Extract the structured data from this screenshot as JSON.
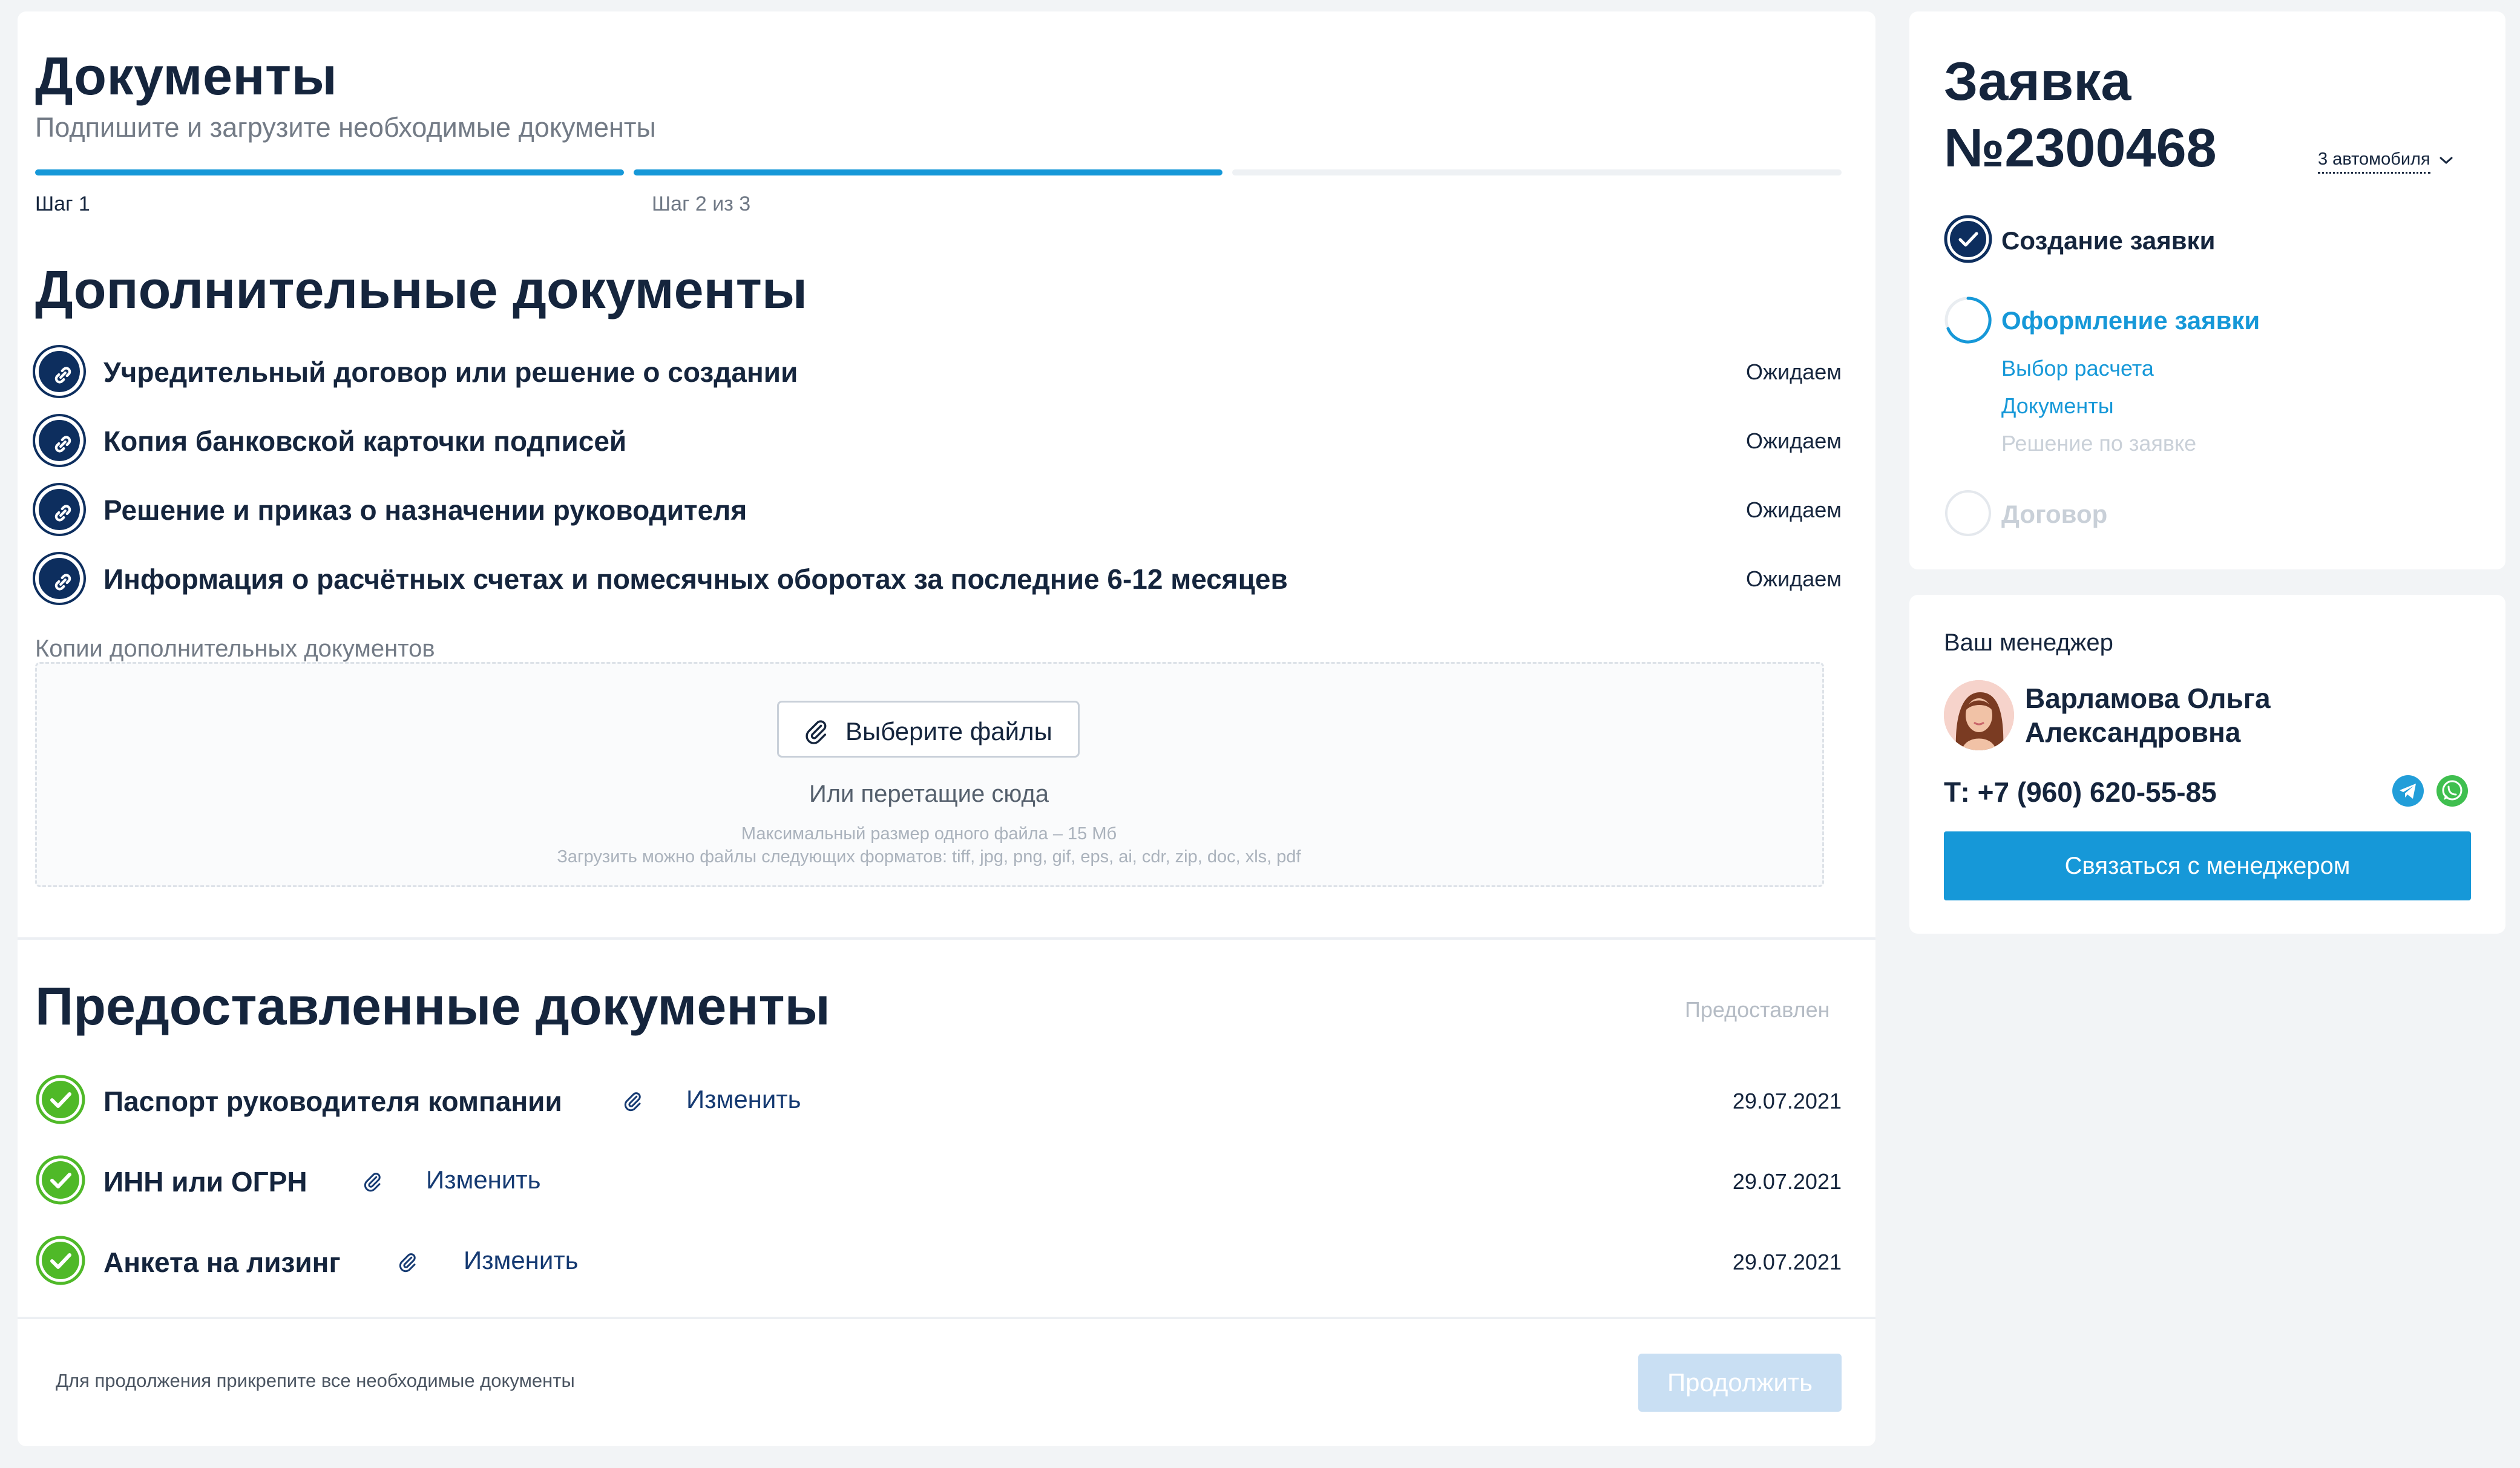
{
  "header": {
    "title": "Документы",
    "subtitle": "Подпишите и загрузите необходимые документы",
    "step1_label": "Шаг 1",
    "step2_label": "Шаг 2 из 3",
    "progress_steps_completed": 2,
    "progress_steps_total": 3
  },
  "additional": {
    "title": "Дополнительные документы",
    "items": [
      {
        "title": "Учредительный договор или решение о создании",
        "status": "Ожидаем"
      },
      {
        "title": "Копия банковской карточки подписей",
        "status": "Ожидаем"
      },
      {
        "title": "Решение и приказ о назначении руководителя",
        "status": "Ожидаем"
      },
      {
        "title": "Информация о расчётных счетах и помесячных оборотах за последние 6-12 месяцев",
        "status": "Ожидаем"
      }
    ],
    "copies_label": "Копии дополнительных документов",
    "upload": {
      "button_label": "Выберите файлы",
      "drag_text": "Или перетащие сюда",
      "max_size_hint": "Максимальный размер одного файла – 15 Мб",
      "formats_hint": "Загрузить можно файлы следующих форматов: tiff, jpg, png, gif, eps, ai, cdr, zip, doc, xls, pdf"
    }
  },
  "provided": {
    "title": "Предоставленные документы",
    "status_header": "Предоставлен",
    "items": [
      {
        "title": "Паспорт руководителя компании",
        "action": "Изменить",
        "date": "29.07.2021"
      },
      {
        "title": "ИНН или ОГРН",
        "action": "Изменить",
        "date": "29.07.2021"
      },
      {
        "title": "Анкета на лизинг",
        "action": "Изменить",
        "date": "29.07.2021"
      }
    ]
  },
  "footer": {
    "note": "Для продолжения прикрепите все необходимые документы",
    "continue_label": "Продолжить"
  },
  "application": {
    "title_line1": "Заявка",
    "title_line2": "№2300468",
    "cars_label": "3 автомобиля",
    "stages": [
      {
        "label": "Создание заявки",
        "state": "done"
      },
      {
        "label": "Оформление заявки",
        "state": "active"
      },
      {
        "label": "Договор",
        "state": "pending"
      }
    ],
    "substeps": [
      {
        "label": "Выбор расчета",
        "state": "done"
      },
      {
        "label": "Документы",
        "state": "active"
      },
      {
        "label": "Решение по заявке",
        "state": "pending"
      }
    ]
  },
  "manager": {
    "heading": "Ваш менеджер",
    "name_line1": "Варламова Ольга",
    "name_line2": "Александровна",
    "phone": "Т: +7 (960) 620-55-85",
    "contact_button": "Связаться с менеджером"
  },
  "colors": {
    "accent": "#1698d8",
    "navy": "#0d2e5e",
    "success": "#4fb928",
    "muted": "#737b86",
    "disabled_button": "#c9dff3"
  }
}
